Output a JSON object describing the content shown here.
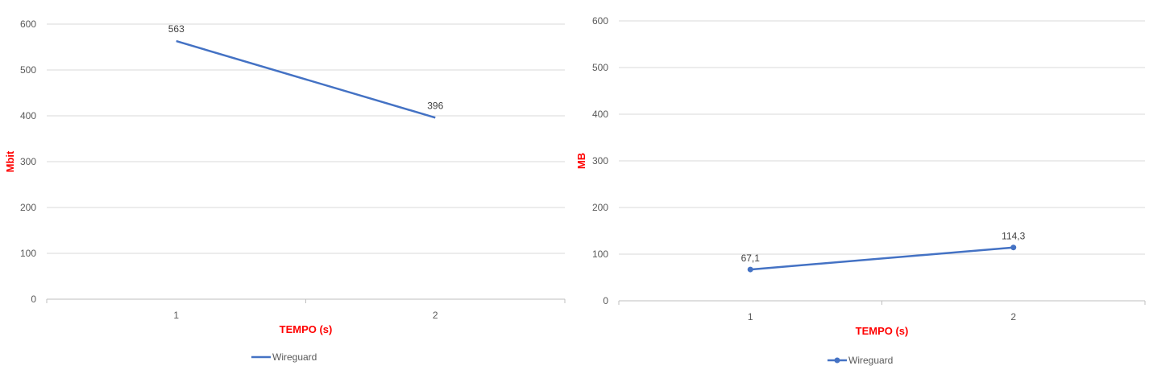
{
  "chart_data": [
    {
      "type": "line",
      "categories": [
        "1",
        "2"
      ],
      "series": [
        {
          "name": "Wireguard",
          "values": [
            563,
            396
          ],
          "color": "#4472c4",
          "markers": false
        }
      ],
      "data_labels": [
        "563",
        "396"
      ],
      "xlabel": "TEMPO (s)",
      "ylabel": "Mbit",
      "ylim": [
        0,
        600
      ],
      "yticks": [
        "0",
        "100",
        "200",
        "300",
        "400",
        "500",
        "600"
      ],
      "grid": true,
      "legend": "bottom",
      "axis_title_color": "#ff0000"
    },
    {
      "type": "line",
      "categories": [
        "1",
        "2"
      ],
      "series": [
        {
          "name": "Wireguard",
          "values": [
            67.1,
            114.3
          ],
          "color": "#4472c4",
          "markers": true
        }
      ],
      "data_labels": [
        "67,1",
        "114,3"
      ],
      "xlabel": "TEMPO (s)",
      "ylabel": "MB",
      "ylim": [
        0,
        600
      ],
      "yticks": [
        "0",
        "100",
        "200",
        "300",
        "400",
        "500",
        "600"
      ],
      "grid": true,
      "legend": "bottom",
      "axis_title_color": "#ff0000"
    }
  ]
}
